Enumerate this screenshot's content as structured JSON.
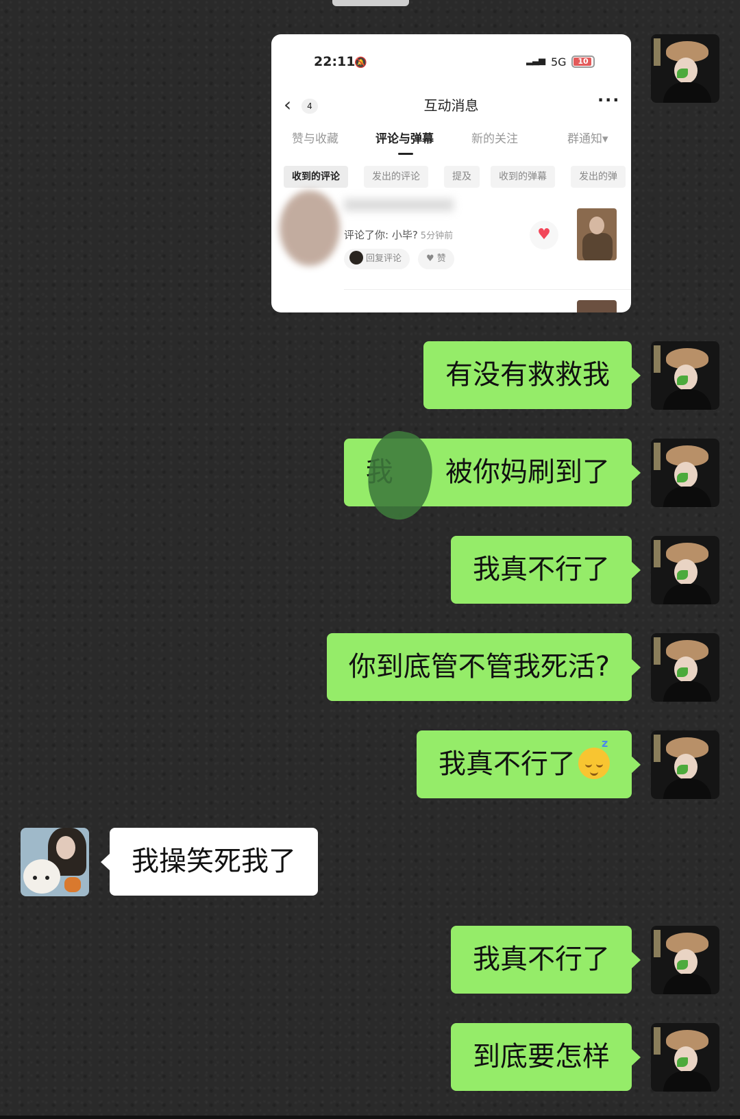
{
  "shot": {
    "status_time": "22:11",
    "network": "5G",
    "battery": "10",
    "back_count": "4",
    "title": "互动消息",
    "tabs": [
      "赞与收藏",
      "评论与弹幕",
      "新的关注",
      "群通知▾"
    ],
    "chips": [
      "收到的评论",
      "发出的评论",
      "提及",
      "收到的弹幕",
      "发出的弹"
    ],
    "comment": {
      "text": "评论了你: 小毕?",
      "time": "5分钟前",
      "reply_label": "回复评论",
      "like_label": "赞"
    }
  },
  "messages": [
    {
      "from": "me",
      "text": "有没有救救我"
    },
    {
      "from": "me",
      "text": "我      被你妈刷到了"
    },
    {
      "from": "me",
      "text": "我真不行了"
    },
    {
      "from": "me",
      "text": "你到底管不管我死活?"
    },
    {
      "from": "me",
      "text": "我真不行了",
      "emoji": "sleeping-face-emoji"
    },
    {
      "from": "friend",
      "text": "我操笑死我了"
    },
    {
      "from": "me",
      "text": "我真不行了"
    },
    {
      "from": "me",
      "text": "到底要怎样"
    }
  ],
  "colors": {
    "my_bubble": "#95ec69",
    "friend_bubble": "#ffffff",
    "background": "#2a2a2a"
  }
}
